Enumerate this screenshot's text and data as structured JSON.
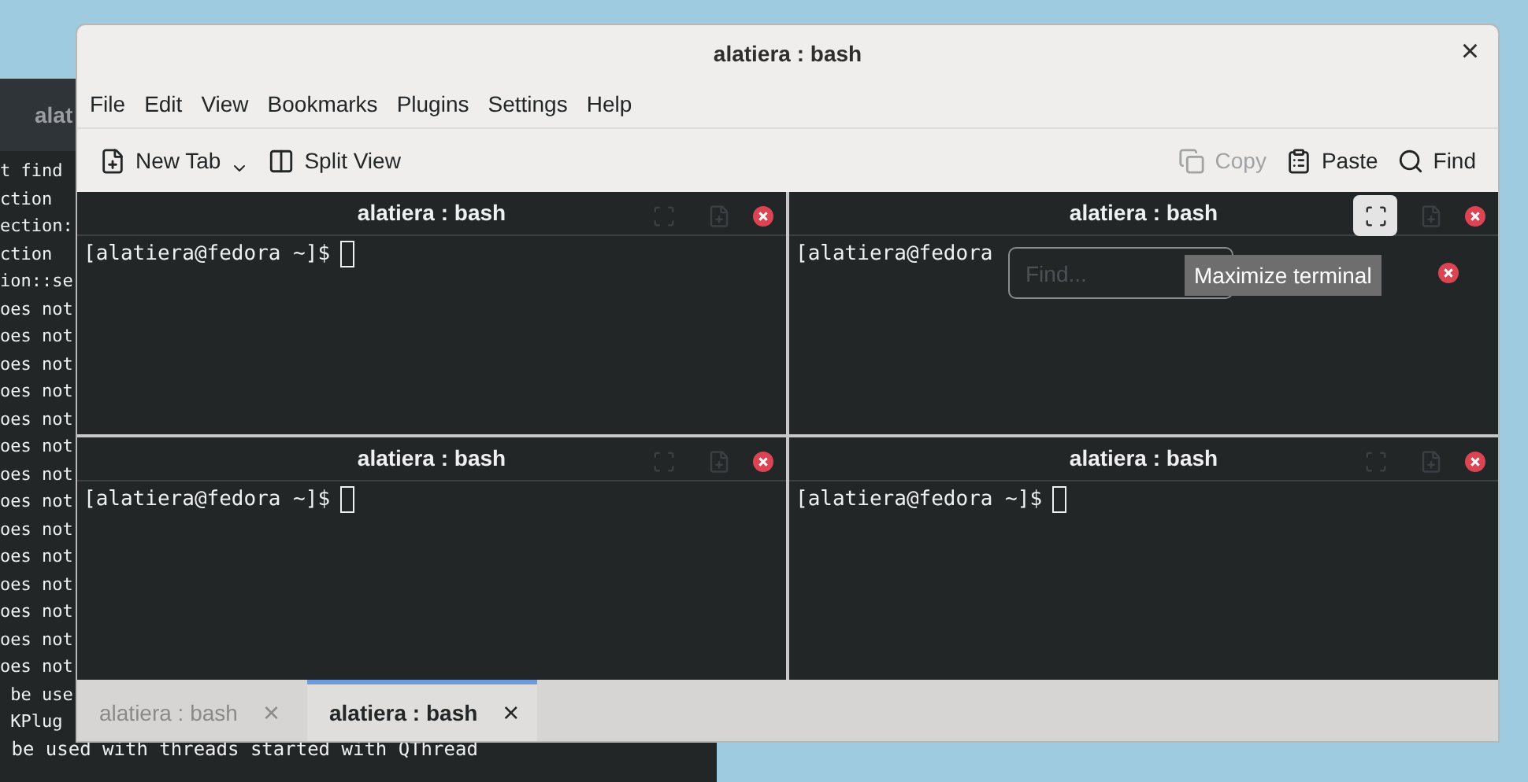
{
  "background_terminal": {
    "title": "alat",
    "lines": [
      "t find",
      "ction",
      "ection:",
      "ction",
      "ion::se",
      "oes not",
      "oes not",
      "oes not",
      "oes not",
      "oes not",
      "oes not",
      "oes not",
      "oes not",
      "oes not",
      "oes not",
      "oes not",
      "oes not",
      "oes not",
      "oes not",
      " be use",
      " KPlug"
    ],
    "last_line": " be used with threads started with QThread"
  },
  "window": {
    "title": "alatiera : bash",
    "close": "×"
  },
  "menu": [
    "File",
    "Edit",
    "View",
    "Bookmarks",
    "Plugins",
    "Settings",
    "Help"
  ],
  "toolbar": [
    {
      "label": "New Tab",
      "kind": "new-tab",
      "dropdown": true,
      "disabled": false
    },
    {
      "label": "Split View",
      "kind": "split",
      "dropdown": false,
      "disabled": false
    },
    {
      "label": "Copy",
      "kind": "copy",
      "dropdown": false,
      "disabled": true
    },
    {
      "label": "Paste",
      "kind": "paste",
      "dropdown": false,
      "disabled": false
    },
    {
      "label": "Find",
      "kind": "find",
      "dropdown": false,
      "disabled": false
    }
  ],
  "panes": [
    {
      "title": "alatiera : bash",
      "prompt": "[alatiera@fedora ~]$",
      "cursor": true,
      "maximize_hovered": false
    },
    {
      "title": "alatiera : bash",
      "prompt": "[alatiera@fedora",
      "cursor": false,
      "maximize_hovered": true,
      "find_bar": {
        "placeholder": "Find..."
      },
      "tooltip": "Maximize terminal"
    },
    {
      "title": "alatiera : bash",
      "prompt": "[alatiera@fedora ~]$",
      "cursor": true,
      "maximize_hovered": false
    },
    {
      "title": "alatiera : bash",
      "prompt": "[alatiera@fedora ~]$",
      "cursor": true,
      "maximize_hovered": false
    }
  ],
  "tabs": [
    {
      "label": "alatiera : bash",
      "close": "×",
      "selected": false
    },
    {
      "label": "alatiera : bash",
      "close": "×",
      "selected": true
    }
  ]
}
